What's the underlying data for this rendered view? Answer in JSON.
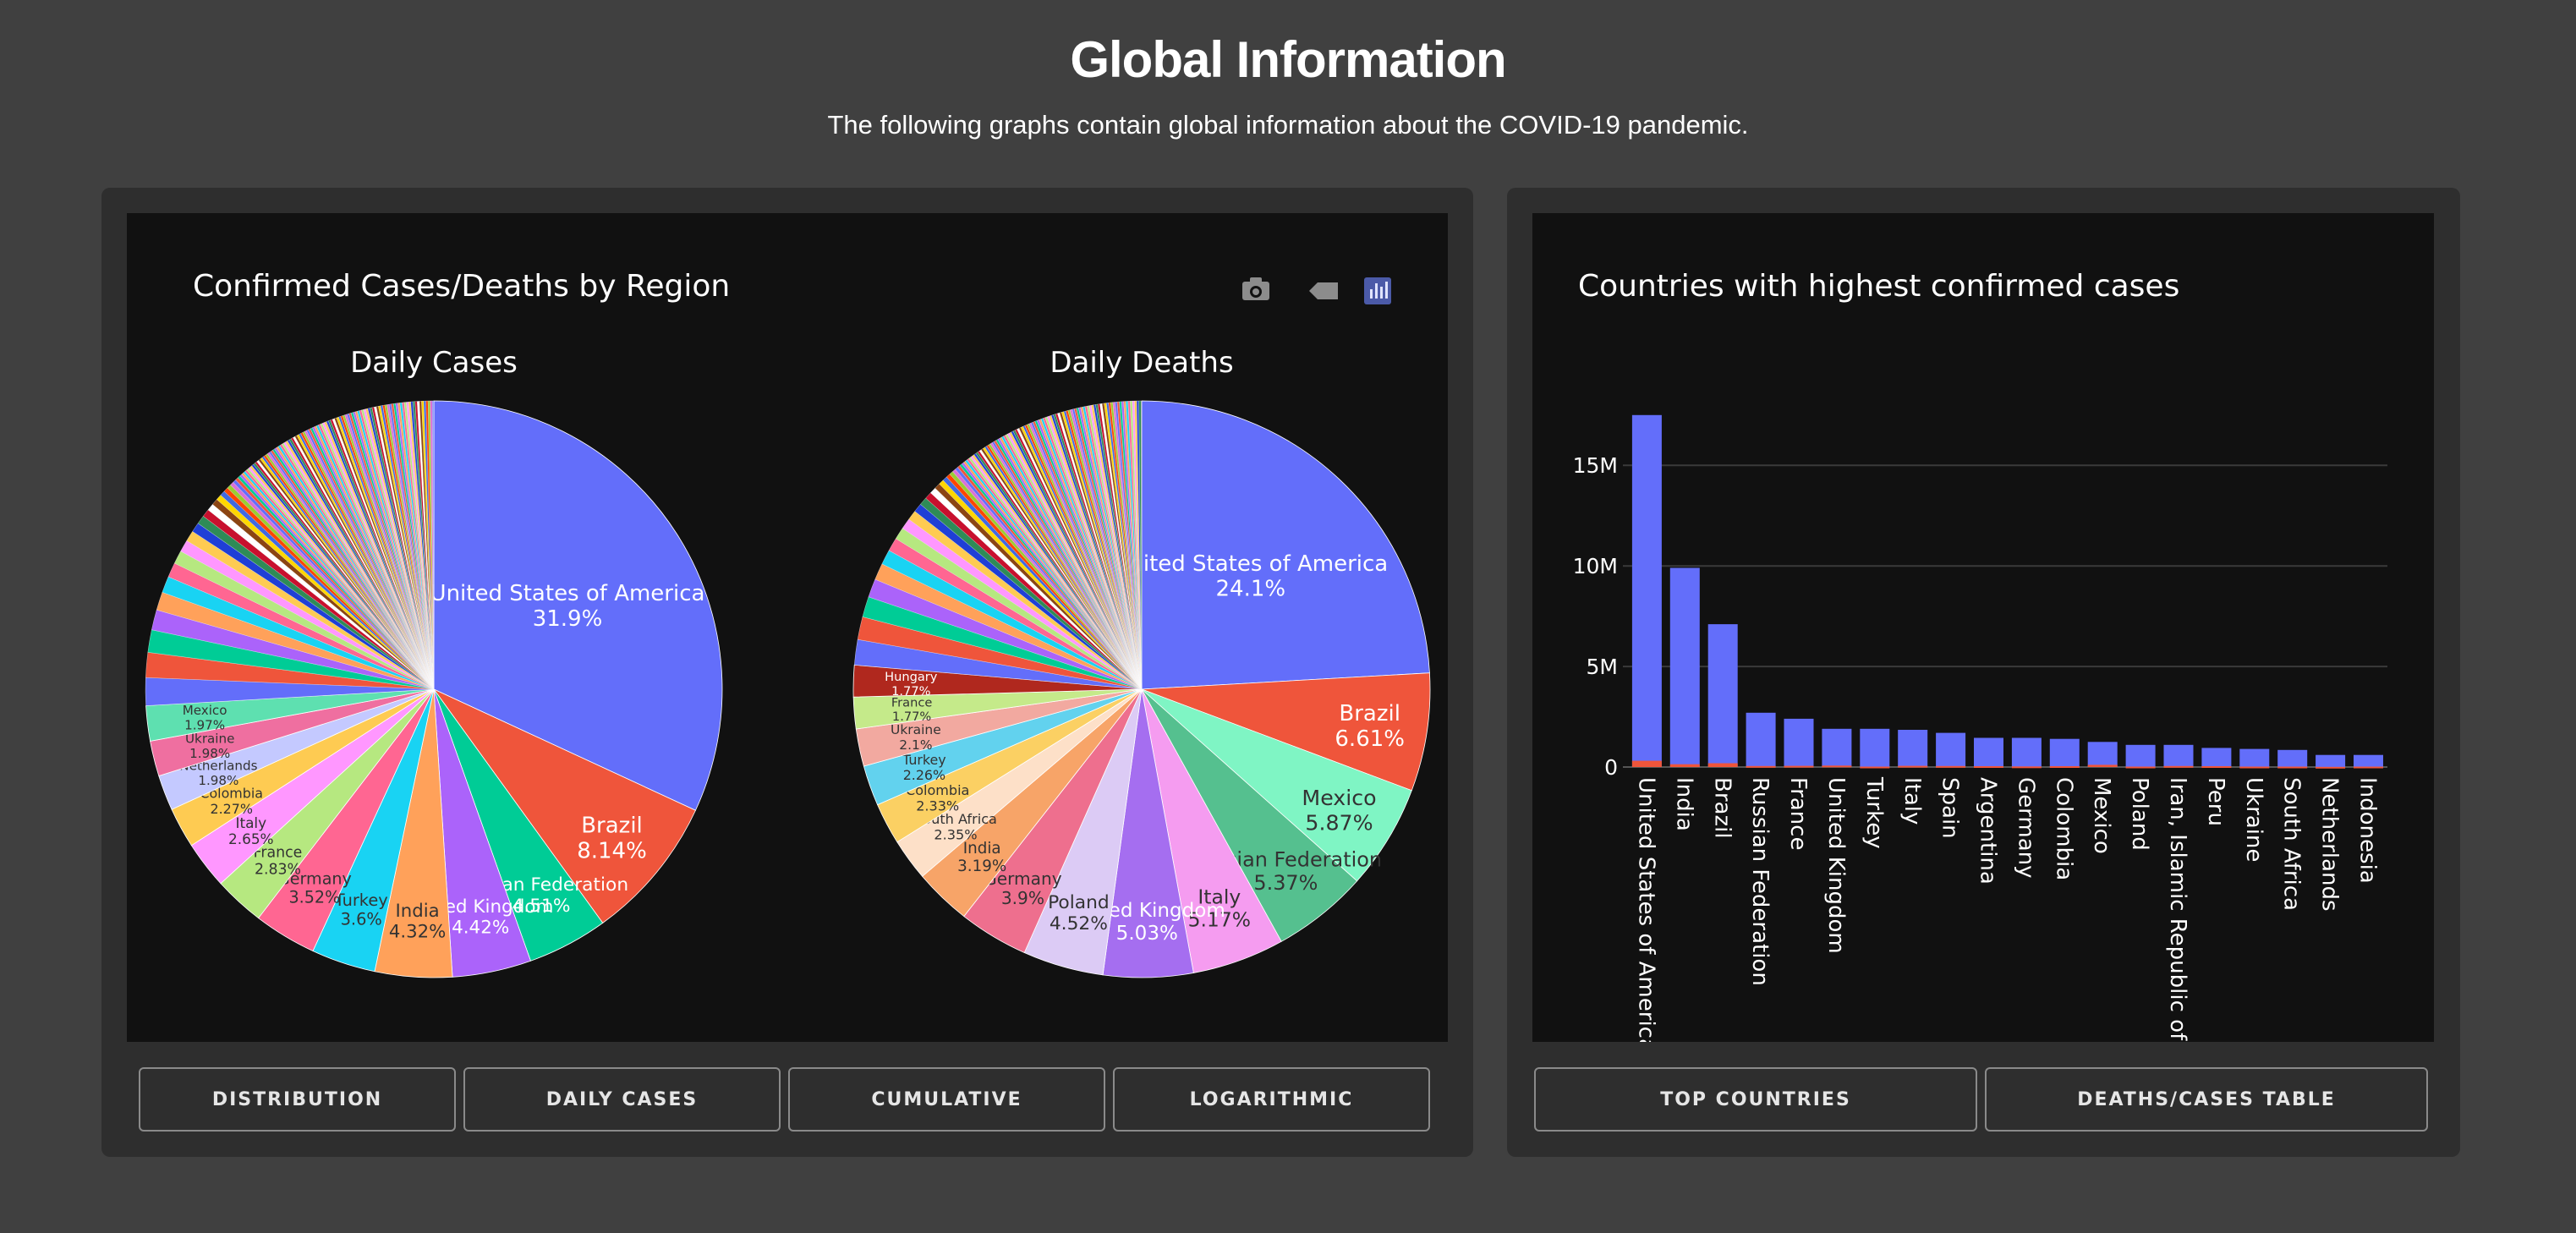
{
  "header": {
    "title": "Global Information",
    "subtitle": "The following graphs contain global information about the COVID-19 pandemic."
  },
  "left_panel": {
    "figure_title": "Confirmed Cases/Deaths by Region",
    "modebar_icons": [
      "camera-icon",
      "tag-icon",
      "bar-chart-icon"
    ],
    "buttons": [
      "DISTRIBUTION",
      "DAILY CASES",
      "CUMULATIVE",
      "LOGARITHMIC"
    ]
  },
  "right_panel": {
    "buttons": [
      "TOP COUNTRIES",
      "DEATHS/CASES TABLE"
    ]
  },
  "colors": {
    "page_bg": "#404040",
    "card_bg": "#2e2e2e",
    "plot_bg": "#111111",
    "cases_bar": "#636efa",
    "deaths_bar": "#ef553b"
  },
  "chart_data": [
    {
      "type": "pie",
      "title": "Daily Cases",
      "slices": [
        {
          "label": "United States of America",
          "value": 31.9,
          "text": "31.9%",
          "color": "#636efa"
        },
        {
          "label": "Brazil",
          "value": 8.14,
          "text": "8.14%",
          "color": "#ef553b"
        },
        {
          "label": "Russian Federation",
          "value": 4.51,
          "text": "4.51%",
          "color": "#00cc96"
        },
        {
          "label": "United Kingdom",
          "value": 4.42,
          "text": "4.42%",
          "color": "#ab63fa"
        },
        {
          "label": "India",
          "value": 4.32,
          "text": "4.32%",
          "color": "#ffa15a"
        },
        {
          "label": "Turkey",
          "value": 3.6,
          "text": "3.6%",
          "color": "#19d3f3"
        },
        {
          "label": "Germany",
          "value": 3.52,
          "text": "3.52%",
          "color": "#ff6692"
        },
        {
          "label": "France",
          "value": 2.83,
          "text": "2.83%",
          "color": "#b6e880"
        },
        {
          "label": "Italy",
          "value": 2.65,
          "text": "2.65%",
          "color": "#ff97ff"
        },
        {
          "label": "Colombia",
          "value": 2.27,
          "text": "2.27%",
          "color": "#fecb52"
        },
        {
          "label": "Netherlands",
          "value": 1.98,
          "text": "1.98%",
          "color": "#c4c9ff"
        },
        {
          "label": "Ukraine",
          "value": 1.98,
          "text": "1.98%",
          "color": "#ef6fa0"
        },
        {
          "label": "Mexico",
          "value": 1.97,
          "text": "1.97%",
          "color": "#5ee0b0"
        }
      ]
    },
    {
      "type": "pie",
      "title": "Daily Deaths",
      "slices": [
        {
          "label": "United States of America",
          "value": 24.1,
          "text": "24.1%",
          "color": "#636efa"
        },
        {
          "label": "Brazil",
          "value": 6.61,
          "text": "6.61%",
          "color": "#ef553b"
        },
        {
          "label": "Mexico",
          "value": 5.87,
          "text": "5.87%",
          "color": "#7ff5c4"
        },
        {
          "label": "Russian Federation",
          "value": 5.37,
          "text": "5.37%",
          "color": "#55c08f"
        },
        {
          "label": "Italy",
          "value": 5.17,
          "text": "5.17%",
          "color": "#f59cf0"
        },
        {
          "label": "United Kingdom",
          "value": 5.03,
          "text": "5.03%",
          "color": "#a56ef0"
        },
        {
          "label": "Poland",
          "value": 4.52,
          "text": "4.52%",
          "color": "#dccbf5"
        },
        {
          "label": "Germany",
          "value": 3.9,
          "text": "3.9%",
          "color": "#ee6f8e"
        },
        {
          "label": "India",
          "value": 3.19,
          "text": "3.19%",
          "color": "#f7a468"
        },
        {
          "label": "South Africa",
          "value": 2.35,
          "text": "2.35%",
          "color": "#fde0c8"
        },
        {
          "label": "Colombia",
          "value": 2.33,
          "text": "2.33%",
          "color": "#fbd063"
        },
        {
          "label": "Turkey",
          "value": 2.26,
          "text": "2.26%",
          "color": "#62d2ee"
        },
        {
          "label": "Ukraine",
          "value": 2.1,
          "text": "2.1%",
          "color": "#f2a9a0"
        },
        {
          "label": "France",
          "value": 1.77,
          "text": "1.77%",
          "color": "#c5ea8a"
        },
        {
          "label": "Hungary",
          "value": 1.77,
          "text": "1.77%",
          "color": "#b0281e"
        }
      ]
    },
    {
      "type": "bar",
      "title": "Countries with highest confirmed cases",
      "categories": [
        "United States of America",
        "India",
        "Brazil",
        "Russian Federation",
        "France",
        "United Kingdom",
        "Turkey",
        "Italy",
        "Spain",
        "Argentina",
        "Germany",
        "Colombia",
        "Mexico",
        "Poland",
        "Iran, Islamic Republic of",
        "Peru",
        "Ukraine",
        "South Africa",
        "Netherlands",
        "Indonesia"
      ],
      "series": [
        {
          "values": [
            17.5,
            9.9,
            7.1,
            2.7,
            2.4,
            1.9,
            1.9,
            1.85,
            1.7,
            1.45,
            1.45,
            1.4,
            1.25,
            1.1,
            1.1,
            0.95,
            0.9,
            0.85,
            0.6,
            0.6
          ]
        },
        {
          "values": [
            0.31,
            0.14,
            0.19,
            0.05,
            0.06,
            0.07,
            0.02,
            0.06,
            0.05,
            0.04,
            0.03,
            0.04,
            0.11,
            0.02,
            0.05,
            0.04,
            0.02,
            0.02,
            0.01,
            0.02
          ]
        }
      ],
      "yticks": [
        "0",
        "5M",
        "10M",
        "15M"
      ],
      "ylim": [
        0,
        18.5
      ],
      "unit": "M",
      "grid": true
    }
  ]
}
